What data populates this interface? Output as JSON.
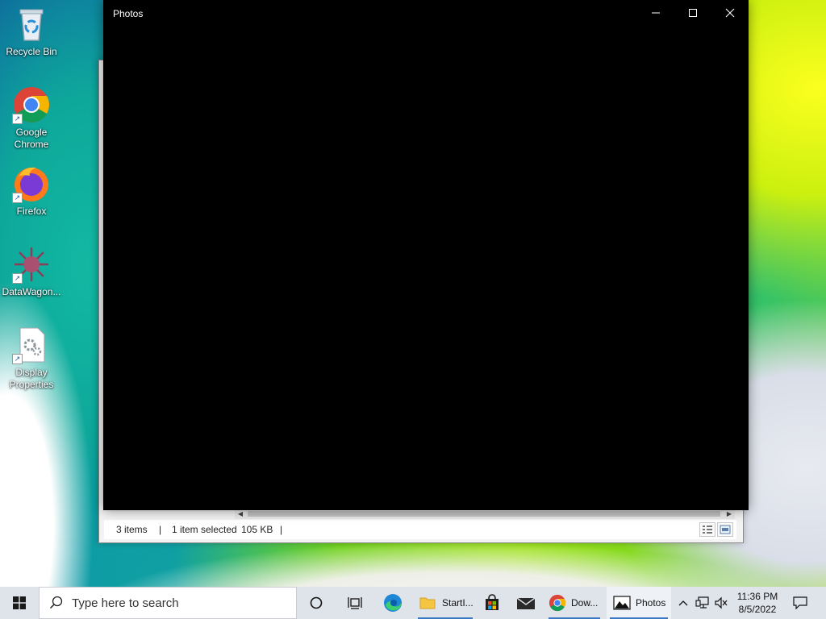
{
  "desktop": {
    "icons": [
      {
        "label": "Recycle Bin"
      },
      {
        "label": "Google Chrome"
      },
      {
        "label": "Firefox"
      },
      {
        "label": "DataWagon..."
      },
      {
        "label": "Display Properties"
      }
    ]
  },
  "photos_window": {
    "title": "Photos",
    "minimize_icon": "minimize-icon",
    "maximize_icon": "maximize-icon",
    "close_icon": "close-icon"
  },
  "explorer_window": {
    "status": {
      "item_count": "3 items",
      "selection": "1 item selected",
      "size": "105 KB"
    }
  },
  "taskbar": {
    "search_placeholder": "Type here to search",
    "apps": [
      {
        "label": "",
        "icon": "cortana-icon"
      },
      {
        "label": "",
        "icon": "task-view-icon"
      },
      {
        "label": "",
        "icon": "edge-icon"
      },
      {
        "label": "StartI...",
        "icon": "folder-icon"
      },
      {
        "label": "",
        "icon": "store-icon"
      },
      {
        "label": "",
        "icon": "mail-icon"
      },
      {
        "label": "Dow...",
        "icon": "chrome-icon"
      },
      {
        "label": "Photos",
        "icon": "photos-icon"
      }
    ],
    "clock": {
      "time": "11:36 PM",
      "date": "8/5/2022"
    }
  },
  "colors": {
    "taskbar": "#dfe3ea",
    "accent": "#3b78c4",
    "photos_bg": "#000000"
  }
}
